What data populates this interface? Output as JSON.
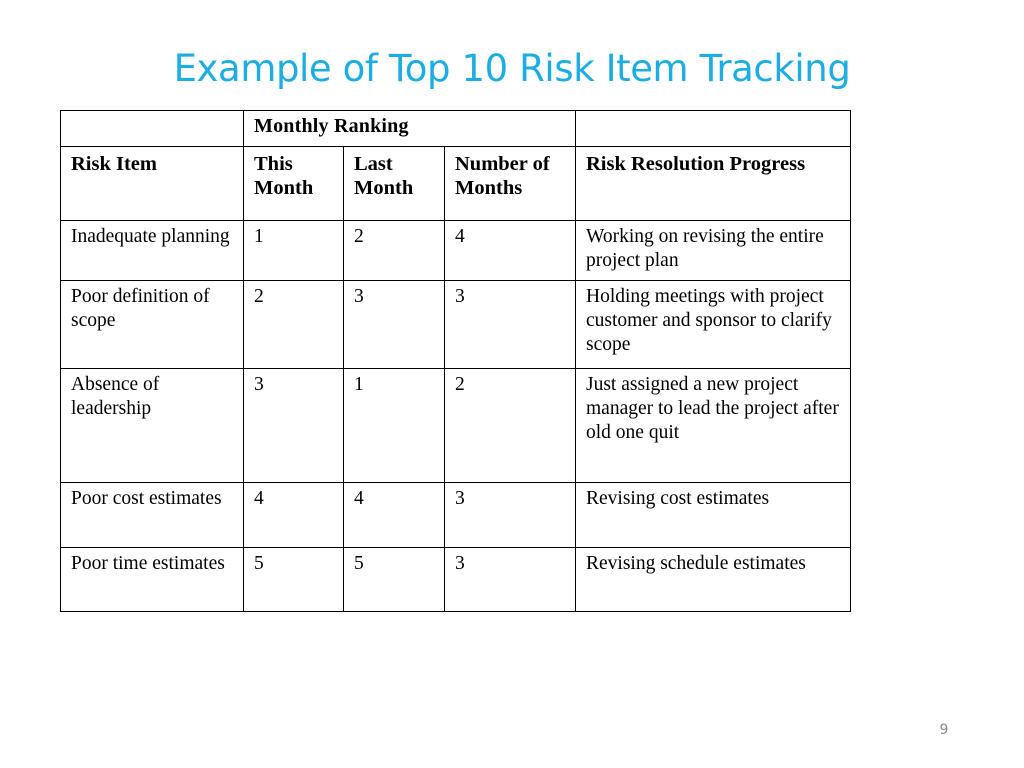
{
  "slide": {
    "title": "Example of Top 10 Risk Item Tracking",
    "title_color": "#1CADE4",
    "page_number": "9",
    "background_color": "#FFFFFF"
  },
  "table": {
    "group_header": {
      "blank_label": "",
      "monthly_ranking_label": "Monthly Ranking",
      "progress_blank_label": ""
    },
    "columns": [
      {
        "key": "risk_item",
        "label": "Risk Item"
      },
      {
        "key": "this_month",
        "label": "This Month"
      },
      {
        "key": "last_month",
        "label": "Last Month"
      },
      {
        "key": "number_of_months",
        "label": "Number of Months"
      },
      {
        "key": "risk_resolution_progress",
        "label": "Risk Resolution Progress"
      }
    ],
    "rows": [
      {
        "risk_item": "Inadequate planning",
        "this_month": "1",
        "last_month": "2",
        "number_of_months": "4",
        "risk_resolution_progress": "Working on revising the entire project plan"
      },
      {
        "risk_item": "Poor definition of scope",
        "this_month": "2",
        "last_month": "3",
        "number_of_months": "3",
        "risk_resolution_progress": "Holding meetings with project customer and sponsor to clarify scope"
      },
      {
        "risk_item": "Absence of leadership",
        "this_month": "3",
        "last_month": "1",
        "number_of_months": "2",
        "risk_resolution_progress": "Just assigned a new project manager to lead the project after old one quit"
      },
      {
        "risk_item": "Poor cost estimates",
        "this_month": "4",
        "last_month": "4",
        "number_of_months": "3",
        "risk_resolution_progress": "Revising cost estimates"
      },
      {
        "risk_item": "Poor time estimates",
        "this_month": "5",
        "last_month": "5",
        "number_of_months": "3",
        "risk_resolution_progress": "Revising schedule estimates"
      }
    ]
  }
}
